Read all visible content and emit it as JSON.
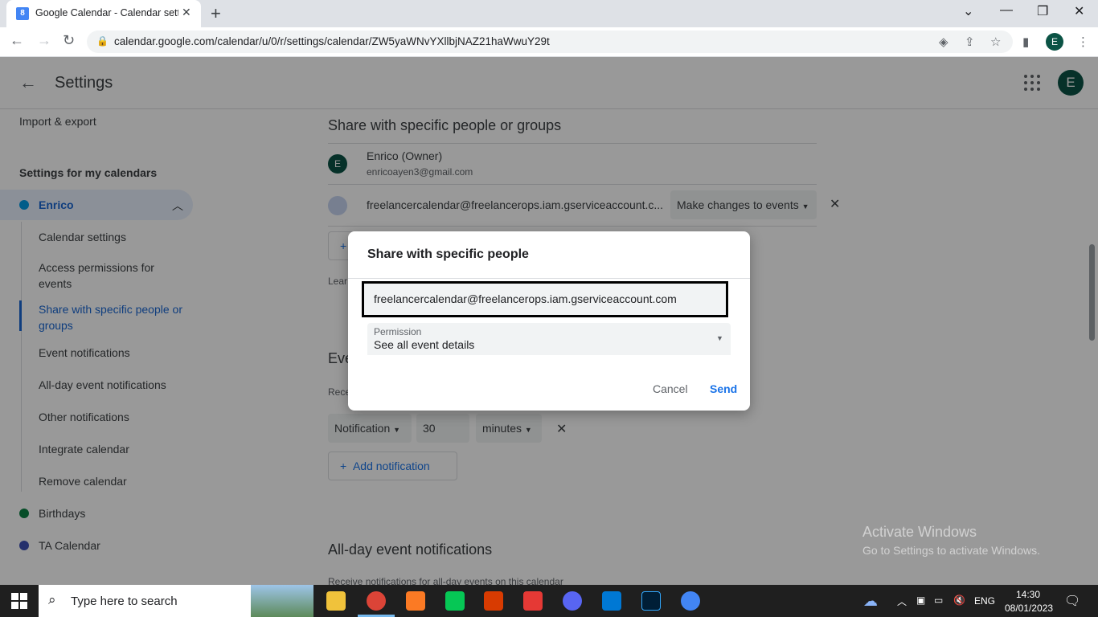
{
  "browser": {
    "tab_title": "Google Calendar - Calendar settings",
    "tab_favicon": "8",
    "url": "calendar.google.com/calendar/u/0/r/settings/calendar/ZW5yaWNvYXllbjNAZ21haWwuY29t",
    "profile_initial": "E"
  },
  "header": {
    "title": "Settings",
    "avatar_initial": "E"
  },
  "sidebar": {
    "import_export": "Import & export",
    "section_heading": "Settings for my calendars",
    "calendar_name": "Enrico",
    "sub_items": [
      "Calendar settings",
      "Access permissions for events",
      "Share with specific people or groups",
      "Event notifications",
      "All-day event notifications",
      "Other notifications",
      "Integrate calendar",
      "Remove calendar"
    ],
    "other_calendars": [
      "Birthdays",
      "TA Calendar"
    ],
    "colors": {
      "enrico": "#039be5",
      "birthdays": "#0b8043",
      "ta_calendar": "#3f51b5",
      "active": "#1967d2"
    }
  },
  "main": {
    "share_title": "Share with specific people or groups",
    "owner_initial": "E",
    "owner_name": "Enrico (Owner)",
    "owner_email": "enricoayen3@gmail.com",
    "shared_email": "freelancercalendar@freelancerops.iam.gserviceaccount.c...",
    "shared_permission": "Make changes to events",
    "learn_more_partial": "Lear",
    "event_notif_partial": "Eve",
    "receive_partial": "Rece",
    "notification_type": "Notification",
    "notification_value": "30",
    "notification_unit": "minutes",
    "add_notification": "Add notification",
    "allday_title": "All-day event notifications",
    "allday_desc": "Receive notifications for all-day events on this calendar"
  },
  "dialog": {
    "title": "Share with specific people",
    "email_value": "freelancercalendar@freelancerops.iam.gserviceaccount.com",
    "permission_label": "Permission",
    "permission_value": "See all event details",
    "cancel": "Cancel",
    "send": "Send"
  },
  "watermark": {
    "line1": "Activate Windows",
    "line2": "Go to Settings to activate Windows."
  },
  "taskbar": {
    "search_placeholder": "Type here to search",
    "language": "ENG",
    "time": "14:30",
    "date": "08/01/2023"
  }
}
